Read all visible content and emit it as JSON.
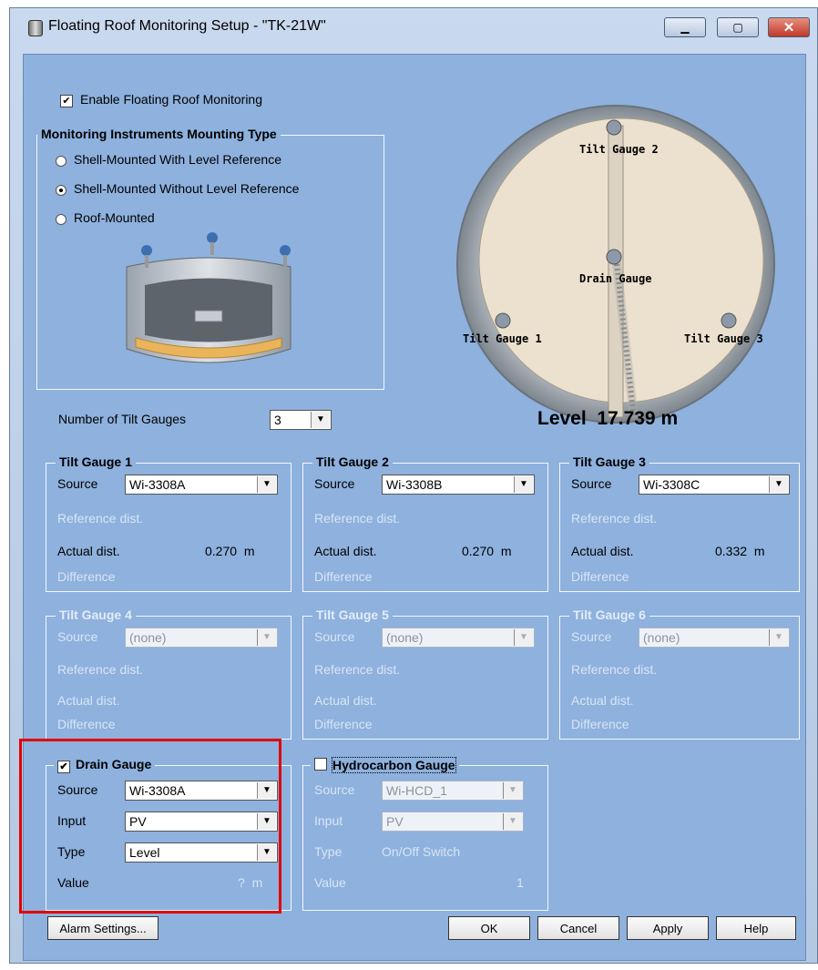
{
  "window": {
    "title": "Floating Roof Monitoring Setup -  \"TK-21W\"",
    "min_glyph": "▁",
    "max_glyph": "▢",
    "close_glyph": "✕"
  },
  "enable": {
    "label": "Enable Floating Roof Monitoring",
    "checked": true
  },
  "mounting": {
    "title": "Monitoring Instruments Mounting Type",
    "options": [
      {
        "label": "Shell-Mounted With Level Reference",
        "selected": false
      },
      {
        "label": "Shell-Mounted Without Level Reference",
        "selected": true
      },
      {
        "label": "Roof-Mounted",
        "selected": false
      }
    ]
  },
  "diagram": {
    "tilt_gauge_1": "Tilt Gauge 1",
    "tilt_gauge_2": "Tilt Gauge 2",
    "tilt_gauge_3": "Tilt Gauge 3",
    "drain_gauge": "Drain Gauge"
  },
  "num_tilt": {
    "label": "Number of Tilt Gauges",
    "value": "3"
  },
  "level": {
    "label": "Level",
    "value": "17.739 m"
  },
  "tilt_gauges": [
    {
      "title": "Tilt Gauge 1",
      "source_label": "Source",
      "source": "Wi-3308A",
      "ref_label": "Reference dist.",
      "actual_label": "Actual dist.",
      "actual_value": "0.270  m",
      "diff_label": "Difference"
    },
    {
      "title": "Tilt Gauge 2",
      "source_label": "Source",
      "source": "Wi-3308B",
      "ref_label": "Reference dist.",
      "actual_label": "Actual dist.",
      "actual_value": "0.270  m",
      "diff_label": "Difference"
    },
    {
      "title": "Tilt Gauge 3",
      "source_label": "Source",
      "source": "Wi-3308C",
      "ref_label": "Reference dist.",
      "actual_label": "Actual dist.",
      "actual_value": "0.332  m",
      "diff_label": "Difference"
    },
    {
      "title": "Tilt Gauge 4",
      "source_label": "Source",
      "source": "(none)",
      "ref_label": "Reference dist.",
      "actual_label": "Actual dist.",
      "diff_label": "Difference"
    },
    {
      "title": "Tilt Gauge 5",
      "source_label": "Source",
      "source": "(none)",
      "ref_label": "Reference dist.",
      "actual_label": "Actual dist.",
      "diff_label": "Difference"
    },
    {
      "title": "Tilt Gauge 6",
      "source_label": "Source",
      "source": "(none)",
      "ref_label": "Reference dist.",
      "actual_label": "Actual dist.",
      "diff_label": "Difference"
    }
  ],
  "drain": {
    "title": "Drain Gauge",
    "checked": true,
    "source_label": "Source",
    "source": "Wi-3308A",
    "input_label": "Input",
    "input": "PV",
    "type_label": "Type",
    "type": "Level",
    "value_label": "Value",
    "value": "?  m"
  },
  "hydro": {
    "title": "Hydrocarbon Gauge",
    "checked": false,
    "source_label": "Source",
    "source": "Wi-HCD_1",
    "input_label": "Input",
    "input": "PV",
    "type_label": "Type",
    "type": "On/Off Switch",
    "value_label": "Value",
    "value": "1"
  },
  "buttons": {
    "alarm": "Alarm Settings...",
    "ok": "OK",
    "cancel": "Cancel",
    "apply": "Apply",
    "help": "Help"
  },
  "colors": {
    "dialog_bg": "#8eb1de",
    "highlight": "#e30000"
  }
}
